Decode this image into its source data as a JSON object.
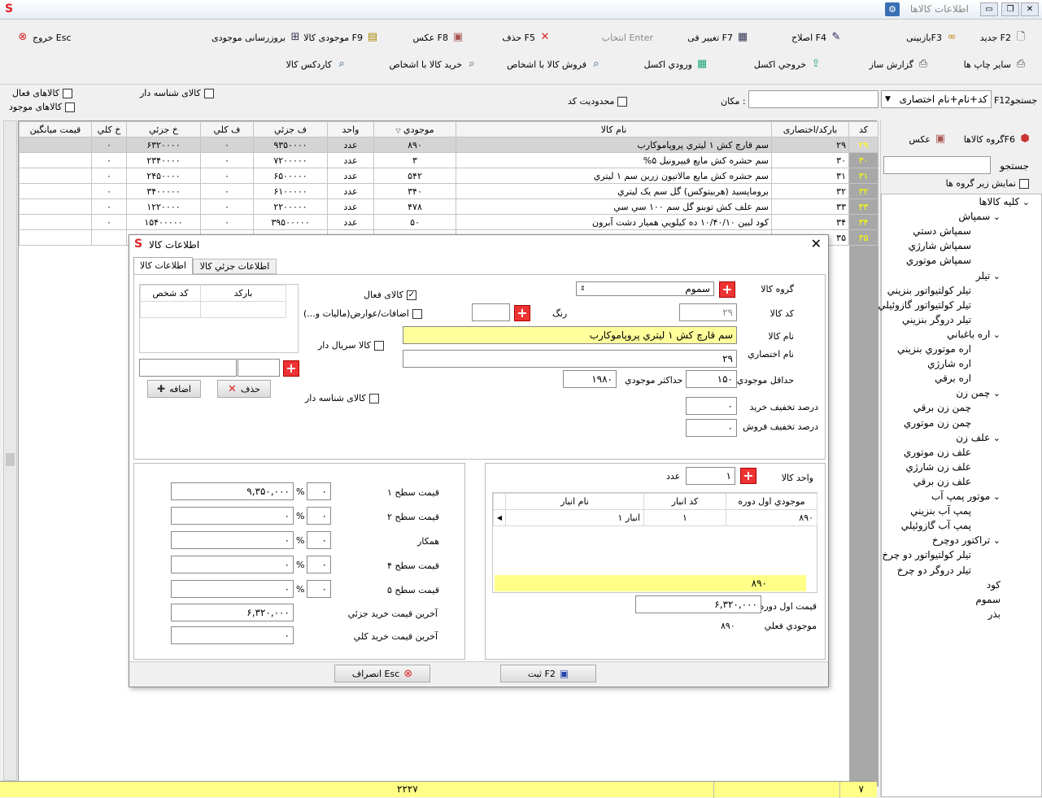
{
  "window": {
    "title": "اطلاعات کالاها",
    "logo": "S"
  },
  "toolbar": {
    "row1": [
      {
        "name": "new-button",
        "label": "جدید F2",
        "icon": "🗋"
      },
      {
        "name": "review-button",
        "label": "بازبینیF3",
        "icon": "👓"
      },
      {
        "name": "edit-button",
        "label": "اصلاح F4",
        "icon": "✎"
      },
      {
        "name": "change-price-button",
        "label": "تغییر فی F7",
        "icon": "▦"
      },
      {
        "name": "select-button",
        "label": "انتخاب Enter",
        "icon": ""
      },
      {
        "name": "delete-button",
        "label": "حذف F5",
        "icon": "✕"
      },
      {
        "name": "photo-button",
        "label": "عکس F8",
        "icon": "▣"
      },
      {
        "name": "stock-button",
        "label": "موجودی کالا F9",
        "icon": "▤"
      },
      {
        "name": "update-stock-button",
        "label": "بروزرسانی موجودی",
        "icon": "⊞"
      },
      {
        "name": "exit-button",
        "label": "خروج Esc",
        "icon": "✖"
      }
    ],
    "row2": [
      {
        "name": "other-print-button",
        "label": "سایر چاپ ها",
        "icon": "⎙"
      },
      {
        "name": "report-builder-button",
        "label": "گزارش ساز",
        "icon": "⎙"
      },
      {
        "name": "excel-export-button",
        "label": "خروجي اکسل",
        "icon": "⇪"
      },
      {
        "name": "excel-import-button",
        "label": "ورودي اکسل",
        "icon": "▦"
      },
      {
        "name": "sell-person-button",
        "label": "فروش کالا با اشخاص",
        "icon": "🔍"
      },
      {
        "name": "buy-person-button",
        "label": "خريد کالا با اشخاص",
        "icon": "🔍"
      },
      {
        "name": "cardex-button",
        "label": "کاردکس کالا",
        "icon": "🔍"
      }
    ]
  },
  "filters": {
    "search_label": "F12جستجو",
    "search_mode": "کد+نام+نام اختصاری",
    "location_label": "مکان :",
    "active_goods": "کالاهای فعال",
    "existing_goods": "کالاهای موجود",
    "serial_goods": "کالای شناسه دار",
    "code_limit": "محدودیت کد"
  },
  "grid": {
    "headers": [
      "کد",
      "بارکد/اختصاری",
      "نام کالا",
      "موجودي",
      "واحد",
      "ف جزئي",
      "ف کلي",
      "خ جزئي",
      "خ کلي",
      "قيمت ميانگين"
    ],
    "rows": [
      [
        "۲۹",
        "۲۹",
        "سم قارچ کش ۱ ليتري پروپاموکارب",
        "۸۹۰",
        "عدد",
        "۹۳۵۰۰۰۰",
        "۰",
        "۶۳۲۰۰۰۰",
        "۰",
        ""
      ],
      [
        "۳۰",
        "۳۰",
        "سم حشره کش مايع فيپرونيل ۵%",
        "۳",
        "عدد",
        "۷۲۰۰۰۰۰",
        "۰",
        "۲۳۴۰۰۰۰",
        "۰",
        ""
      ],
      [
        "۳۱",
        "۳۱",
        "سم حشره کش مايع مالاتيون زرين سم ۱ ليتري",
        "۵۴۲",
        "عدد",
        "۶۵۰۰۰۰۰",
        "۰",
        "۲۴۵۰۰۰۰",
        "۰",
        ""
      ],
      [
        "۳۲",
        "۳۲",
        "بروماپسيد (هربيتوکس) گل سم يک ليتري",
        "۳۴۰",
        "عدد",
        "۶۱۰۰۰۰۰",
        "۰",
        "۳۴۰۰۰۰۰",
        "۰",
        ""
      ],
      [
        "۳۳",
        "۳۳",
        "سم علف کش توبنو گل سم ۱۰۰ سي سي",
        "۴۷۸",
        "عدد",
        "۲۲۰۰۰۰۰",
        "۰",
        "۱۲۲۰۰۰۰",
        "۰",
        ""
      ],
      [
        "۳۴",
        "۳۴",
        "کود لبين ۱۰/۴۰/۱۰ ده کيلويي هميار دشت آبرون",
        "۵۰",
        "عدد",
        "۳۹۵۰۰۰۰۰",
        "۰",
        "۱۵۴۰۰۰۰۰",
        "۰",
        ""
      ],
      [
        "۳۵",
        "۳۵",
        "",
        "",
        "",
        "",
        "",
        "",
        "",
        ""
      ]
    ],
    "footer_count": "۷",
    "footer_stock": "۲۲۲۷"
  },
  "side": {
    "group_button": "گروه کالاهاF6",
    "photo_button": "عکس",
    "search_label": "جستجو",
    "show_subgroups": "نمایش زير گروه ها",
    "tree": [
      {
        "t": "کليه کالاها",
        "l": 0,
        "exp": true
      },
      {
        "t": "سمپاش",
        "l": 1,
        "exp": true
      },
      {
        "t": "سمپاش دستي",
        "l": 2
      },
      {
        "t": "سمپاش شارژي",
        "l": 2
      },
      {
        "t": "سمپاش موتوري",
        "l": 2
      },
      {
        "t": "تيلر",
        "l": 1,
        "exp": true
      },
      {
        "t": "تيلر کولتيواتور بنزيني",
        "l": 2
      },
      {
        "t": "تيلر کولتيواتور گازوئيلي",
        "l": 2
      },
      {
        "t": "تيلر دروگر بنزيني",
        "l": 2
      },
      {
        "t": "اره باغباني",
        "l": 1,
        "exp": true
      },
      {
        "t": "اره موتوري بنزيني",
        "l": 2
      },
      {
        "t": "اره شارژي",
        "l": 2
      },
      {
        "t": "اره برقي",
        "l": 2
      },
      {
        "t": "چمن زن",
        "l": 1,
        "exp": true
      },
      {
        "t": "چمن زن برقي",
        "l": 2
      },
      {
        "t": "چمن زن موتوري",
        "l": 2
      },
      {
        "t": "علف زن",
        "l": 1,
        "exp": true
      },
      {
        "t": "علف زن موتوري",
        "l": 2
      },
      {
        "t": "علف زن شارژي",
        "l": 2
      },
      {
        "t": "علف زن برقي",
        "l": 2
      },
      {
        "t": "موتور پمپ آب",
        "l": 1,
        "exp": true
      },
      {
        "t": "پمپ آب بنزيني",
        "l": 2
      },
      {
        "t": "پمپ آب گازوئيلي",
        "l": 2
      },
      {
        "t": "تراکتور دوچرخ",
        "l": 1,
        "exp": true
      },
      {
        "t": "تيلر کولتيواتور دو چرخ",
        "l": 2
      },
      {
        "t": "تيلر دروگر دو چرخ",
        "l": 2
      },
      {
        "t": "کود",
        "l": 1
      },
      {
        "t": "سموم",
        "l": 1
      },
      {
        "t": "بذر",
        "l": 1
      }
    ]
  },
  "dialog": {
    "title": "اطلاعات کالا",
    "tab_main": "اطلاعات کالا",
    "tab_detail": "اطلاعات جزئي کالا",
    "group_label": "گروه کالا",
    "group_value": "سموم",
    "code_label": "کد کالا",
    "code_value": "۲۹",
    "color_label": "رنگ",
    "name_label": "نام کالا",
    "name_value": "سم قارچ کش ۱ ليتري پروپاموکارب",
    "short_label": "نام اختصاري",
    "short_value": "۲۹",
    "min_stock_label": "حداقل موجودي",
    "min_stock_value": "۱۵۰",
    "max_stock_label": "حداکثر موجودي",
    "max_stock_value": "۱۹۸۰",
    "buy_discount_label": "درصد تخفيف خريد",
    "buy_discount_value": "۰",
    "sell_discount_label": "درصد تخفيف فروش",
    "sell_discount_value": "۰",
    "active_label": "کالای فعال",
    "extras_label": "اضافات/عوارض(ماليات و...)",
    "serial_label": "کالا سريال دار",
    "identifier_label": "کالای شناسه دار",
    "barcode_headers": [
      "بارکد",
      "کد شخص"
    ],
    "delete_label": "حذف",
    "add_label": "اضافه",
    "unit_label": "واحد کالا",
    "unit_value": "۱",
    "unit_name": "عدد",
    "warehouse_headers": [
      "موجودي اول دوره",
      "کد انبار",
      "نام انبار"
    ],
    "warehouse_rows": [
      [
        "۸۹۰",
        "۱",
        "انبار ۱"
      ]
    ],
    "warehouse_total": "۸۹۰",
    "initial_price_label": "قيمت اول دوره",
    "initial_price_value": "۶,۳۲۰,۰۰۰",
    "current_stock_label": "موجودي فعلي",
    "current_stock_value": "۸۹۰",
    "prices": [
      {
        "label": "قيمت سطح ۱",
        "pct": "۰",
        "value": "۹,۳۵۰,۰۰۰"
      },
      {
        "label": "قيمت سطح ۲",
        "pct": "۰",
        "value": "۰"
      },
      {
        "label": "همکار",
        "pct": "۰",
        "value": "۰"
      },
      {
        "label": "قيمت سطح ۴",
        "pct": "۰",
        "value": "۰"
      },
      {
        "label": "قيمت سطح ۵",
        "pct": "۰",
        "value": "۰"
      }
    ],
    "last_retail_label": "آخرين قيمت خريد جزئي",
    "last_retail_value": "۶,۳۲۰,۰۰۰",
    "last_wholesale_label": "آخرين قيمت خريد کلي",
    "last_wholesale_value": "۰",
    "save_label": "ثبت F2",
    "cancel_label": "انصراف Esc"
  }
}
